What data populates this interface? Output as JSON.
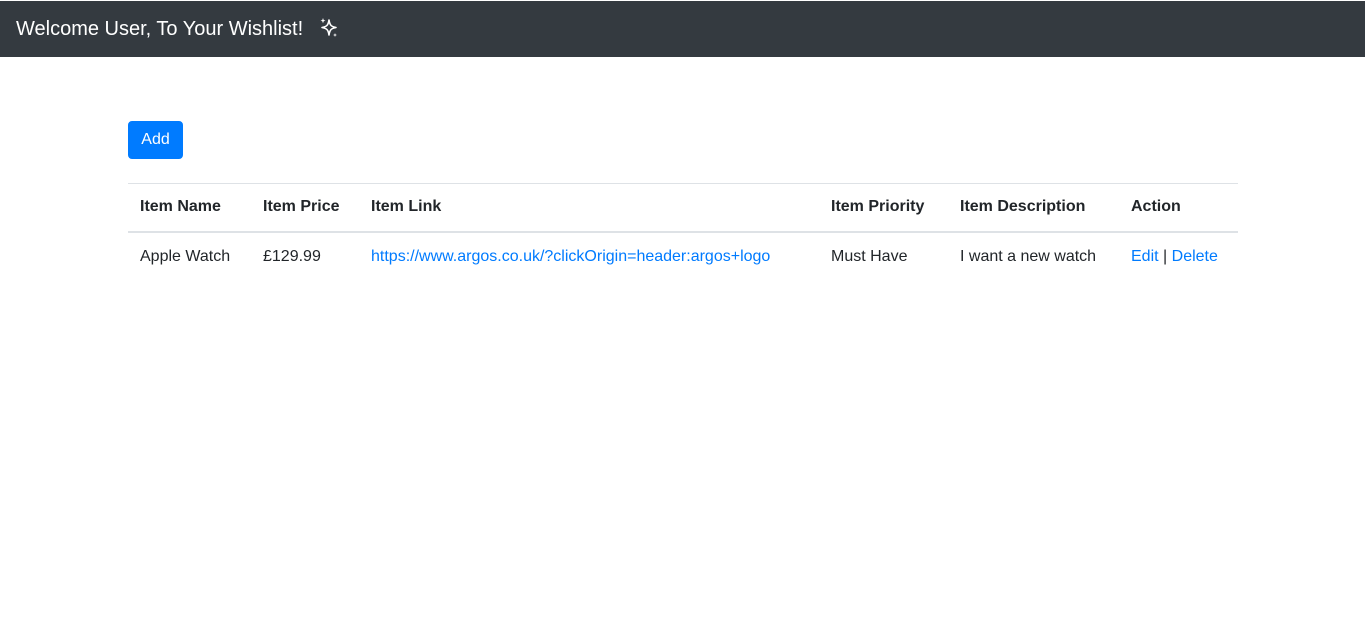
{
  "navbar": {
    "title": "Welcome User, To Your Wishlist!",
    "icon": "sparkle-icon"
  },
  "toolbar": {
    "add_label": "Add"
  },
  "colors": {
    "navbar_bg": "#343a40",
    "primary": "#007bff",
    "text": "#212529",
    "border": "#dee2e6"
  },
  "table": {
    "headers": [
      "Item Name",
      "Item Price",
      "Item Link",
      "Item Priority",
      "Item Description",
      "Action"
    ],
    "rows": [
      {
        "name": "Apple Watch",
        "price": "£129.99",
        "link": "https://www.argos.co.uk/?clickOrigin=header:argos+logo",
        "priority": "Must Have",
        "description": "I want a new watch",
        "edit_label": "Edit",
        "separator": "|",
        "delete_label": "Delete"
      }
    ]
  }
}
